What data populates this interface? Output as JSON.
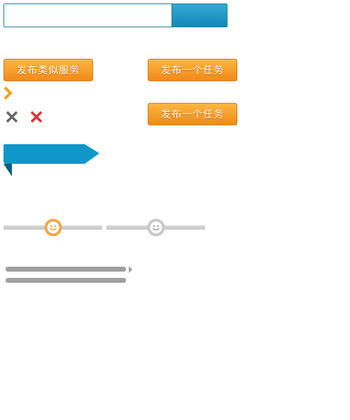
{
  "search": {
    "value": "",
    "placeholder": "",
    "button_label": ""
  },
  "buttons": {
    "publish_similar_service": "发布类似服务",
    "publish_task_primary": "发布一个任务",
    "publish_task_secondary": "发布一个任务"
  },
  "icons": {
    "chevron": "chevron-right-icon",
    "close_gray": "close-icon",
    "close_red": "close-icon",
    "ribbon": "ribbon-banner",
    "slider_handle_active": "smiley-face-icon",
    "slider_handle_inactive": "smiley-face-icon"
  },
  "sliders": [
    {
      "state": "active",
      "value": 0.5
    },
    {
      "state": "inactive",
      "value": 0.5
    }
  ],
  "colors": {
    "accent_blue": "#1287b9",
    "orange": "#f18a1a",
    "close_red": "#e03131",
    "close_gray": "#666666",
    "track_gray": "#c9c9c9",
    "bar_gray": "#a0a0a0"
  }
}
